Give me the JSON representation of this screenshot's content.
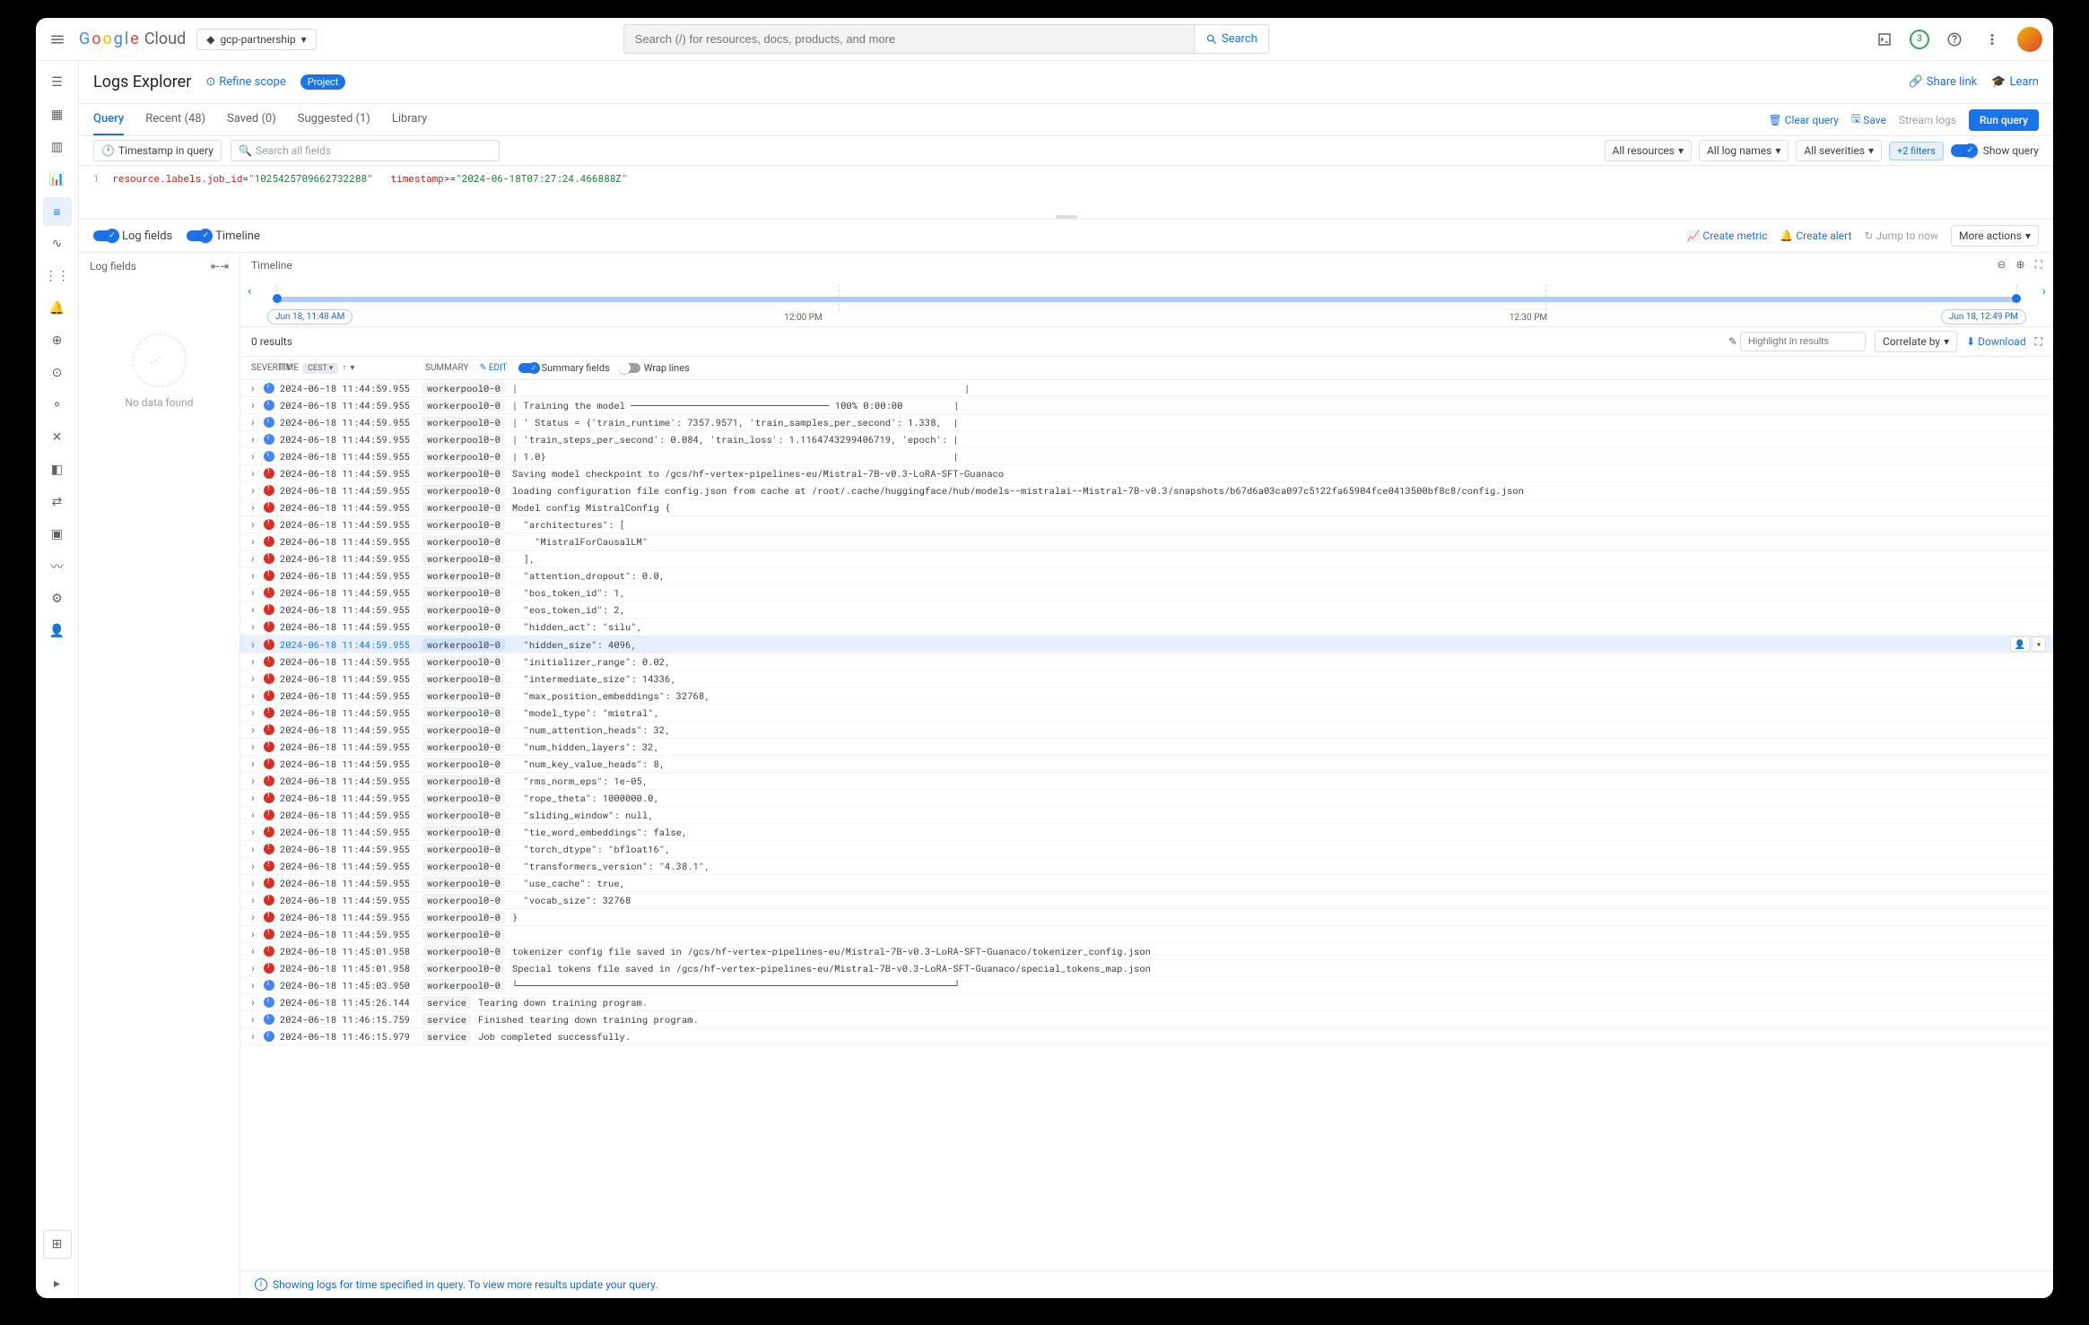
{
  "header": {
    "logo_cloud": "Cloud",
    "project": "gcp-partnership",
    "search_placeholder": "Search (/) for resources, docs, products, and more",
    "search_btn": "Search",
    "trial_count": "3"
  },
  "page": {
    "title": "Logs Explorer",
    "refine_scope": "Refine scope",
    "project_badge": "Project",
    "share_link": "Share link",
    "learn": "Learn"
  },
  "tabs": {
    "query": "Query",
    "recent": "Recent (48)",
    "saved": "Saved (0)",
    "suggested": "Suggested (1)",
    "library": "Library",
    "clear_query": "Clear query",
    "save": "Save",
    "stream_logs": "Stream logs",
    "run_query": "Run query"
  },
  "query_row": {
    "timestamp_chip": "Timestamp in query",
    "search_placeholder": "Search all fields",
    "all_resources": "All resources",
    "all_log_names": "All log names",
    "all_severities": "All severities",
    "filters": "+2 filters",
    "show_query": "Show query"
  },
  "query": {
    "line_no": "1",
    "field1": "resource.labels.job_id",
    "op1": "=",
    "val1": "\"1025425709662732288\"",
    "field2": "timestamp",
    "op2": ">=",
    "val2": "\"2024-06-18T07:27:24.466888Z\""
  },
  "toggles": {
    "log_fields": "Log fields",
    "timeline": "Timeline",
    "create_metric": "Create metric",
    "create_alert": "Create alert",
    "jump_to_now": "Jump to now",
    "more_actions": "More actions"
  },
  "log_fields_panel": {
    "header": "Log fields",
    "no_data": "No data found"
  },
  "timeline": {
    "header": "Timeline",
    "tick1": "12:00 PM",
    "tick2": "12:30 PM",
    "start": "Jun 18, 11:48 AM",
    "end": "Jun 18, 12:49 PM"
  },
  "results": {
    "count": "0 results",
    "highlight_placeholder": "Highlight in results",
    "correlate": "Correlate by",
    "download": "Download"
  },
  "table_header": {
    "severity": "Severity",
    "time": "Time",
    "tz": "CEST",
    "summary": "Summary",
    "edit": "Edit",
    "summary_fields": "Summary fields",
    "wrap_lines": "Wrap lines"
  },
  "logs": [
    {
      "sev": "info",
      "ts": "2024-06-18 11:44:59.955",
      "tag": "workerpool0-0",
      "msg": "|                                                                               |"
    },
    {
      "sev": "info",
      "ts": "2024-06-18 11:44:59.955",
      "tag": "workerpool0-0",
      "msg": "| Training the model ─────────────────────────────────── 100% 0:00:00         |"
    },
    {
      "sev": "info",
      "ts": "2024-06-18 11:44:59.955",
      "tag": "workerpool0-0",
      "msg": "| ' Status = {'train_runtime': 7357.9571, 'train_samples_per_second': 1.338,  |"
    },
    {
      "sev": "info",
      "ts": "2024-06-18 11:44:59.955",
      "tag": "workerpool0-0",
      "msg": "| 'train_steps_per_second': 0.084, 'train_loss': 1.1164743299406719, 'epoch': |"
    },
    {
      "sev": "info",
      "ts": "2024-06-18 11:44:59.955",
      "tag": "workerpool0-0",
      "msg": "| 1.0}                                                                        |"
    },
    {
      "sev": "error",
      "ts": "2024-06-18 11:44:59.955",
      "tag": "workerpool0-0",
      "msg": "Saving model checkpoint to /gcs/hf-vertex-pipelines-eu/Mistral-7B-v0.3-LoRA-SFT-Guanaco"
    },
    {
      "sev": "error",
      "ts": "2024-06-18 11:44:59.955",
      "tag": "workerpool0-0",
      "msg": "loading configuration file config.json from cache at /root/.cache/huggingface/hub/models--mistralai--Mistral-7B-v0.3/snapshots/b67d6a03ca097c5122fa65904fce0413500bf8c8/config.json"
    },
    {
      "sev": "error",
      "ts": "2024-06-18 11:44:59.955",
      "tag": "workerpool0-0",
      "msg": "Model config MistralConfig {"
    },
    {
      "sev": "error",
      "ts": "2024-06-18 11:44:59.955",
      "tag": "workerpool0-0",
      "msg": "  \"architectures\": ["
    },
    {
      "sev": "error",
      "ts": "2024-06-18 11:44:59.955",
      "tag": "workerpool0-0",
      "msg": "    \"MistralForCausalLM\""
    },
    {
      "sev": "error",
      "ts": "2024-06-18 11:44:59.955",
      "tag": "workerpool0-0",
      "msg": "  ],"
    },
    {
      "sev": "error",
      "ts": "2024-06-18 11:44:59.955",
      "tag": "workerpool0-0",
      "msg": "  \"attention_dropout\": 0.0,"
    },
    {
      "sev": "error",
      "ts": "2024-06-18 11:44:59.955",
      "tag": "workerpool0-0",
      "msg": "  \"bos_token_id\": 1,"
    },
    {
      "sev": "error",
      "ts": "2024-06-18 11:44:59.955",
      "tag": "workerpool0-0",
      "msg": "  \"eos_token_id\": 2,"
    },
    {
      "sev": "error",
      "ts": "2024-06-18 11:44:59.955",
      "tag": "workerpool0-0",
      "msg": "  \"hidden_act\": \"silu\","
    },
    {
      "sev": "error",
      "ts": "2024-06-18 11:44:59.955",
      "tag": "workerpool0-0",
      "msg": "  \"hidden_size\": 4096,",
      "hl": true
    },
    {
      "sev": "error",
      "ts": "2024-06-18 11:44:59.955",
      "tag": "workerpool0-0",
      "msg": "  \"initializer_range\": 0.02,"
    },
    {
      "sev": "error",
      "ts": "2024-06-18 11:44:59.955",
      "tag": "workerpool0-0",
      "msg": "  \"intermediate_size\": 14336,"
    },
    {
      "sev": "error",
      "ts": "2024-06-18 11:44:59.955",
      "tag": "workerpool0-0",
      "msg": "  \"max_position_embeddings\": 32768,"
    },
    {
      "sev": "error",
      "ts": "2024-06-18 11:44:59.955",
      "tag": "workerpool0-0",
      "msg": "  \"model_type\": \"mistral\","
    },
    {
      "sev": "error",
      "ts": "2024-06-18 11:44:59.955",
      "tag": "workerpool0-0",
      "msg": "  \"num_attention_heads\": 32,"
    },
    {
      "sev": "error",
      "ts": "2024-06-18 11:44:59.955",
      "tag": "workerpool0-0",
      "msg": "  \"num_hidden_layers\": 32,"
    },
    {
      "sev": "error",
      "ts": "2024-06-18 11:44:59.955",
      "tag": "workerpool0-0",
      "msg": "  \"num_key_value_heads\": 8,"
    },
    {
      "sev": "error",
      "ts": "2024-06-18 11:44:59.955",
      "tag": "workerpool0-0",
      "msg": "  \"rms_norm_eps\": 1e-05,"
    },
    {
      "sev": "error",
      "ts": "2024-06-18 11:44:59.955",
      "tag": "workerpool0-0",
      "msg": "  \"rope_theta\": 1000000.0,"
    },
    {
      "sev": "error",
      "ts": "2024-06-18 11:44:59.955",
      "tag": "workerpool0-0",
      "msg": "  \"sliding_window\": null,"
    },
    {
      "sev": "error",
      "ts": "2024-06-18 11:44:59.955",
      "tag": "workerpool0-0",
      "msg": "  \"tie_word_embeddings\": false,"
    },
    {
      "sev": "error",
      "ts": "2024-06-18 11:44:59.955",
      "tag": "workerpool0-0",
      "msg": "  \"torch_dtype\": \"bfloat16\","
    },
    {
      "sev": "error",
      "ts": "2024-06-18 11:44:59.955",
      "tag": "workerpool0-0",
      "msg": "  \"transformers_version\": \"4.38.1\","
    },
    {
      "sev": "error",
      "ts": "2024-06-18 11:44:59.955",
      "tag": "workerpool0-0",
      "msg": "  \"use_cache\": true,"
    },
    {
      "sev": "error",
      "ts": "2024-06-18 11:44:59.955",
      "tag": "workerpool0-0",
      "msg": "  \"vocab_size\": 32768"
    },
    {
      "sev": "error",
      "ts": "2024-06-18 11:44:59.955",
      "tag": "workerpool0-0",
      "msg": "}"
    },
    {
      "sev": "error",
      "ts": "2024-06-18 11:44:59.955",
      "tag": "workerpool0-0",
      "msg": ""
    },
    {
      "sev": "error",
      "ts": "2024-06-18 11:45:01.958",
      "tag": "workerpool0-0",
      "msg": "tokenizer config file saved in /gcs/hf-vertex-pipelines-eu/Mistral-7B-v0.3-LoRA-SFT-Guanaco/tokenizer_config.json"
    },
    {
      "sev": "error",
      "ts": "2024-06-18 11:45:01.958",
      "tag": "workerpool0-0",
      "msg": "Special tokens file saved in /gcs/hf-vertex-pipelines-eu/Mistral-7B-v0.3-LoRA-SFT-Guanaco/special_tokens_map.json"
    },
    {
      "sev": "info",
      "ts": "2024-06-18 11:45:03.950",
      "tag": "workerpool0-0",
      "msg": "└─────────────────────────────────────────────────────────────────────────────┘"
    },
    {
      "sev": "info",
      "ts": "2024-06-18 11:45:26.144",
      "tag": "service",
      "msg": "Tearing down training program."
    },
    {
      "sev": "info",
      "ts": "2024-06-18 11:46:15.759",
      "tag": "service",
      "msg": "Finished tearing down training program."
    },
    {
      "sev": "info",
      "ts": "2024-06-18 11:46:15.979",
      "tag": "service",
      "msg": "Job completed successfully."
    }
  ],
  "footer": {
    "note": "Showing logs for time specified in query. To view more results update your query."
  }
}
